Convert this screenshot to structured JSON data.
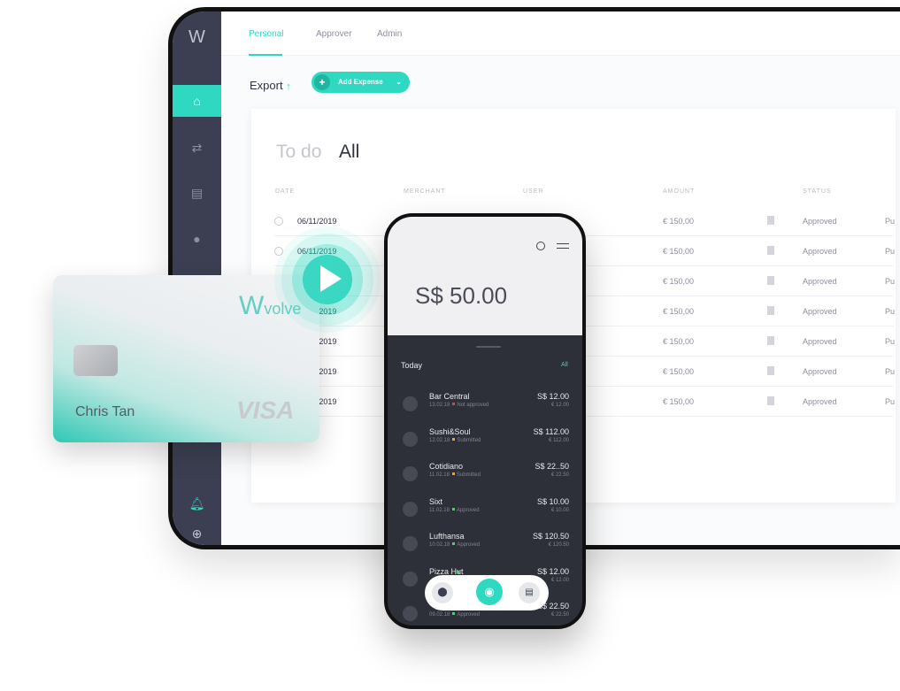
{
  "colors": {
    "accent": "#2fd8c0",
    "sidebar": "#3b3f51",
    "not_approved": "#e0424a",
    "submitted": "#f0a030",
    "approved": "#3bd86a"
  },
  "tabs": [
    "Personal",
    "Approver",
    "Admin"
  ],
  "toolbar": {
    "export_label": "Export",
    "add_expense_label": "Add Expense"
  },
  "card": {
    "title_inactive": "To do",
    "title_active": "All",
    "columns": [
      "DATE",
      "MERCHANT",
      "USER",
      "AMOUNT",
      "STATUS"
    ],
    "rows": [
      {
        "date": "06/11/2019",
        "amount": "€ 150,00",
        "status": "Approved",
        "extra": "Pu"
      },
      {
        "date": "06/11/2019",
        "amount": "€ 150,00",
        "status": "Approved",
        "extra": "Pu"
      },
      {
        "date": "06/11/2019",
        "amount": "€ 150,00",
        "status": "Approved",
        "extra": "Pu"
      },
      {
        "date": "06/11/2019",
        "amount": "€ 150,00",
        "status": "Approved",
        "extra": "Pu"
      },
      {
        "date": "06/11/2019",
        "amount": "€ 150,00",
        "status": "Approved",
        "extra": "Pu"
      },
      {
        "date": "06/11/2019",
        "amount": "€ 150,00",
        "status": "Approved",
        "extra": "Pu"
      },
      {
        "date": "06/11/2019",
        "amount": "€ 150,00",
        "status": "Approved",
        "extra": "Pu"
      }
    ]
  },
  "credit_card": {
    "brand": "volve",
    "holder": "Chris Tan",
    "network": "VISA"
  },
  "phone": {
    "balance": "S$ 50.00",
    "section": "Today",
    "all_link": "All",
    "transactions": [
      {
        "merchant": "Bar Central",
        "date": "13.02.18",
        "status": "Not approved",
        "status_color": "#e0424a",
        "amount": "S$ 12.00",
        "eur": "€ 12.00"
      },
      {
        "merchant": "Sushi&Soul",
        "date": "12.02.18",
        "status": "Submitted",
        "status_color": "#f0a030",
        "amount": "S$ 112.00",
        "eur": "€ 112.00"
      },
      {
        "merchant": "Cotidiano",
        "date": "11.02.18",
        "status": "Submitted",
        "status_color": "#f0a030",
        "amount": "S$ 22..50",
        "eur": "€ 22.50"
      },
      {
        "merchant": "Sixt",
        "date": "11.02.18",
        "status": "Approved",
        "status_color": "#3bd86a",
        "amount": "S$ 10.00",
        "eur": "€ 10.00"
      },
      {
        "merchant": "Lufthansa",
        "date": "10.02.18",
        "status": "Approved",
        "status_color": "#3bd86a",
        "amount": "S$ 120.50",
        "eur": "€ 120.50"
      },
      {
        "merchant": "Pizza Hut",
        "date": "",
        "status": "",
        "status_color": "#3bd86a",
        "amount": "S$ 12.00",
        "eur": "€ 12.00"
      },
      {
        "merchant": "",
        "date": "09.02.18",
        "status": "Approved",
        "status_color": "#3bd86a",
        "amount": "S$ 22.50",
        "eur": "€ 22.50"
      }
    ]
  }
}
